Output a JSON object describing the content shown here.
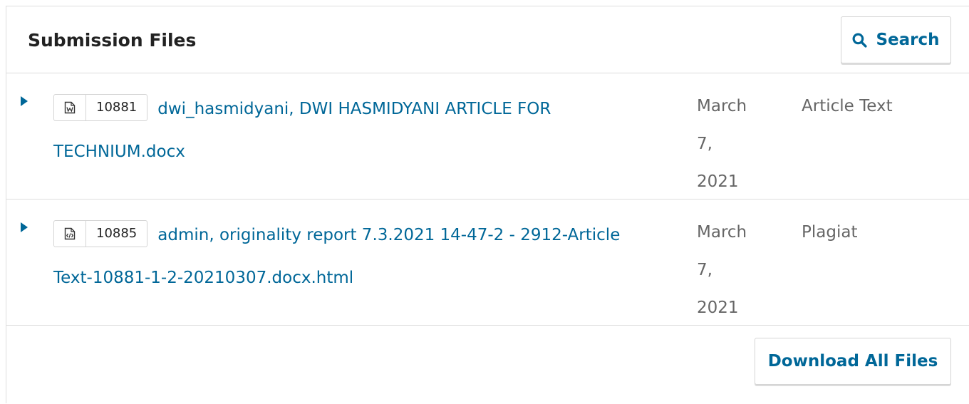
{
  "panel": {
    "title": "Submission Files",
    "search_label": "Search",
    "search_icon": "search-icon"
  },
  "files": [
    {
      "id": "10881",
      "icon": "word-document-icon",
      "name": "dwi_hasmidyani, DWI HASMIDYANI ARTICLE FOR TECHNIUM.docx",
      "date_parts": [
        "March",
        "7,",
        "2021"
      ],
      "type": "Article Text"
    },
    {
      "id": "10885",
      "icon": "html-document-icon",
      "name": "admin, originality report 7.3.2021 14-47-2 - 2912-Article Text-10881-1-2-20210307.docx.html",
      "date_parts": [
        "March",
        "7,",
        "2021"
      ],
      "type": "Plagiat"
    }
  ],
  "footer": {
    "download_all_label": "Download All Files"
  },
  "colors": {
    "link": "#006798",
    "border": "#dddddd",
    "muted_text": "#666666"
  }
}
